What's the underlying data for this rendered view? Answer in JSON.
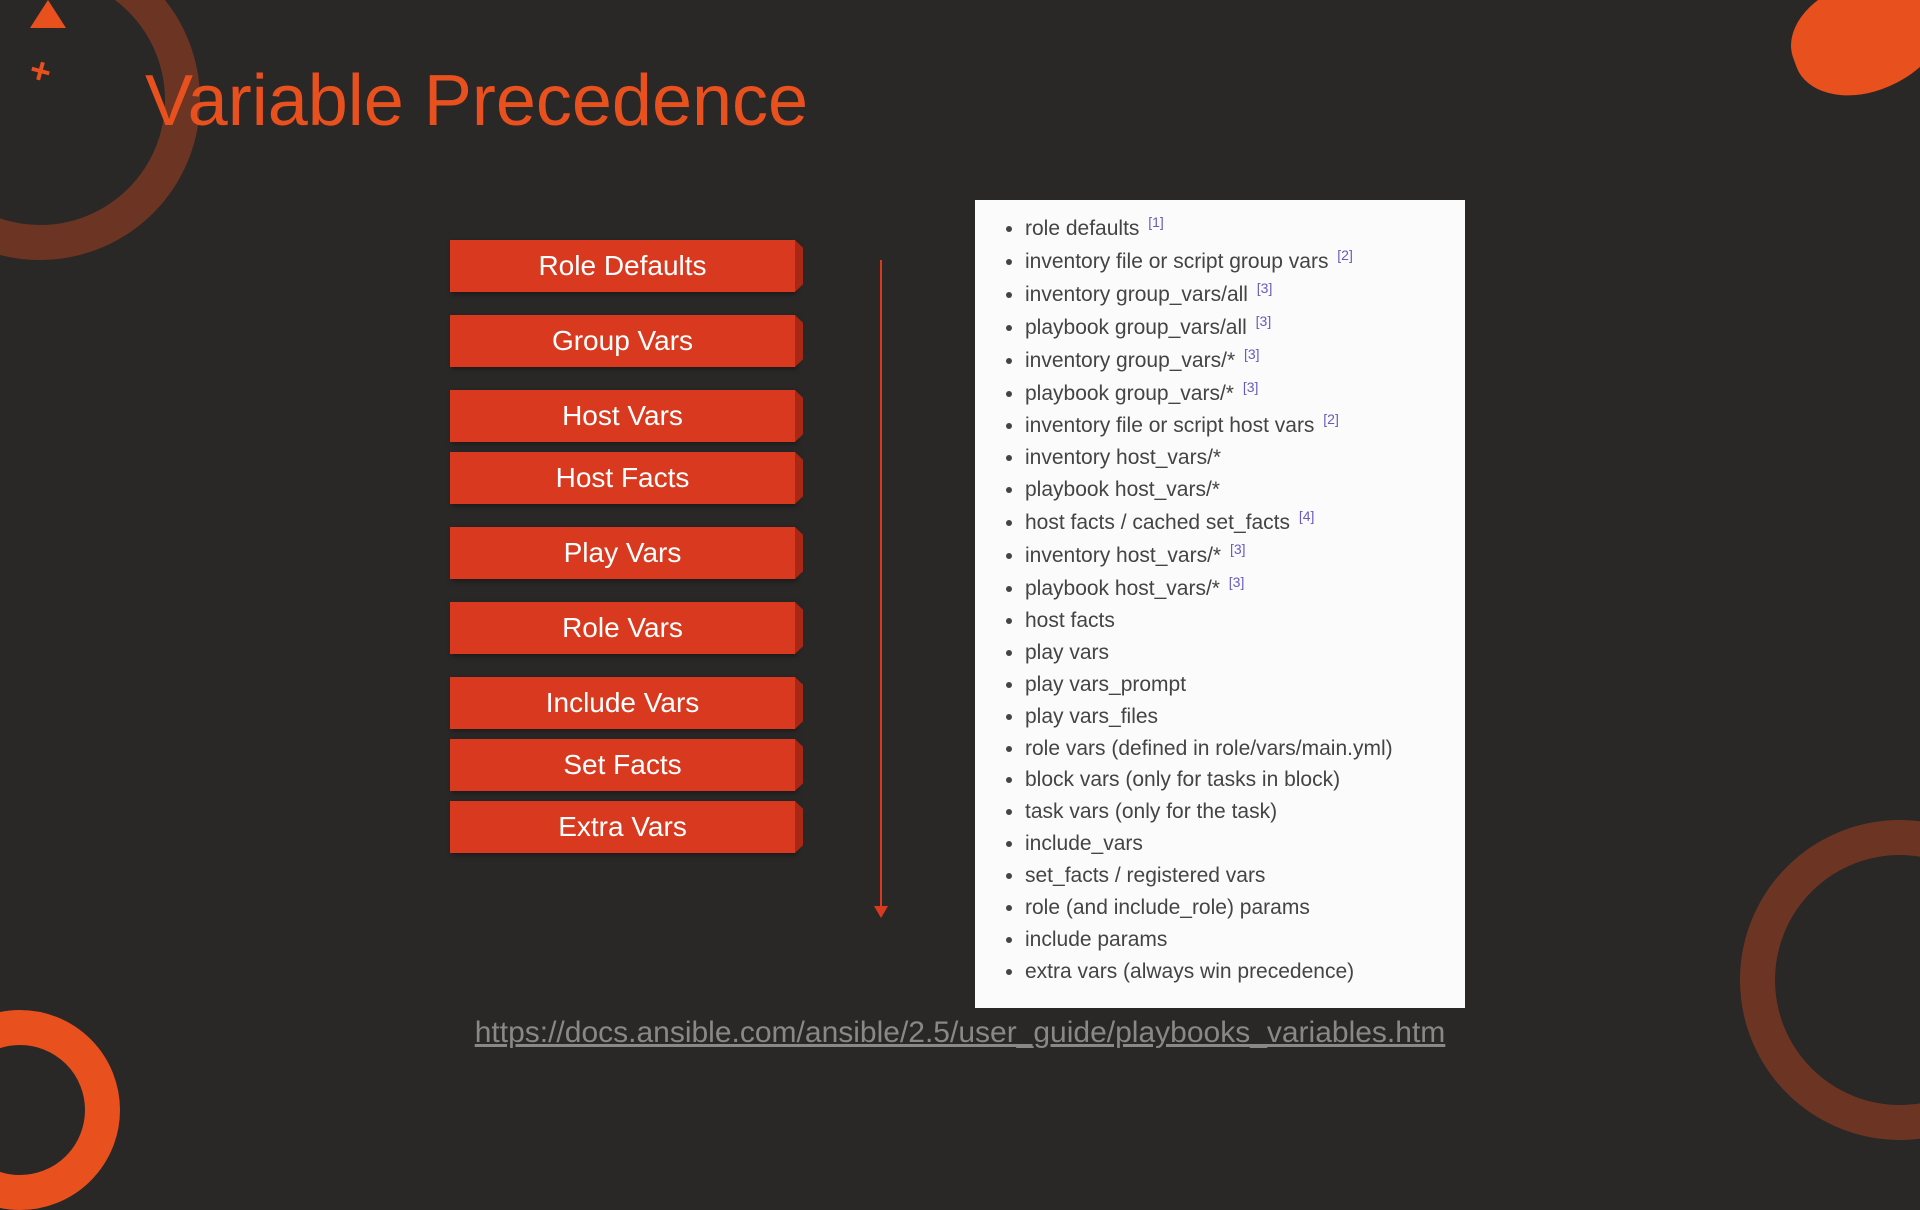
{
  "title": "Variable Precedence",
  "boxes": [
    "Role Defaults",
    "Group Vars",
    "Host Vars",
    "Host Facts",
    "Play Vars",
    "Role Vars",
    "Include Vars",
    "Set Facts",
    "Extra Vars"
  ],
  "list": [
    {
      "text": "role defaults ",
      "ref": "[1]"
    },
    {
      "text": "inventory file or script group vars ",
      "ref": "[2]"
    },
    {
      "text": "inventory group_vars/all ",
      "ref": "[3]"
    },
    {
      "text": "playbook group_vars/all ",
      "ref": "[3]"
    },
    {
      "text": "inventory group_vars/* ",
      "ref": "[3]"
    },
    {
      "text": "playbook group_vars/* ",
      "ref": "[3]"
    },
    {
      "text": "inventory file or script host vars ",
      "ref": "[2]"
    },
    {
      "text": "inventory host_vars/*",
      "ref": ""
    },
    {
      "text": "playbook host_vars/*",
      "ref": ""
    },
    {
      "text": "host facts / cached set_facts ",
      "ref": "[4]"
    },
    {
      "text": "inventory host_vars/* ",
      "ref": "[3]"
    },
    {
      "text": "playbook host_vars/* ",
      "ref": "[3]"
    },
    {
      "text": "host facts",
      "ref": ""
    },
    {
      "text": "play vars",
      "ref": ""
    },
    {
      "text": "play vars_prompt",
      "ref": ""
    },
    {
      "text": "play vars_files",
      "ref": ""
    },
    {
      "text": "role vars (defined in role/vars/main.yml)",
      "ref": ""
    },
    {
      "text": "block vars (only for tasks in block)",
      "ref": ""
    },
    {
      "text": "task vars (only for the task)",
      "ref": ""
    },
    {
      "text": "include_vars",
      "ref": ""
    },
    {
      "text": "set_facts / registered vars",
      "ref": ""
    },
    {
      "text": "role (and include_role) params",
      "ref": ""
    },
    {
      "text": "include params",
      "ref": ""
    },
    {
      "text": "extra vars (always win precedence)",
      "ref": ""
    }
  ],
  "link": "https://docs.ansible.com/ansible/2.5/user_guide/playbooks_variables.htm"
}
